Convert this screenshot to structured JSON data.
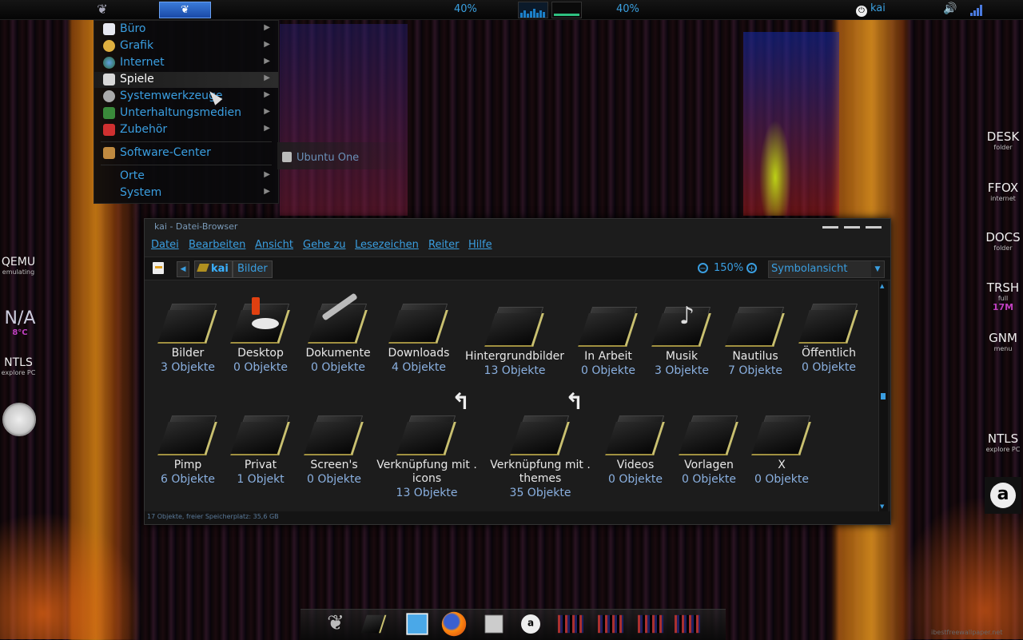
{
  "top_panel": {
    "cpu_left": "40%",
    "cpu_right": "40%",
    "user": "kai",
    "colors": {
      "accent": "#3a9ee0",
      "task_button": "#2a62c8"
    }
  },
  "app_menu": {
    "items": [
      {
        "label": "Büro",
        "icon": "office-icon",
        "has_submenu": true
      },
      {
        "label": "Grafik",
        "icon": "graphics-icon",
        "has_submenu": true
      },
      {
        "label": "Internet",
        "icon": "globe-icon",
        "has_submenu": true
      },
      {
        "label": "Spiele",
        "icon": "games-icon",
        "has_submenu": true,
        "active": true
      },
      {
        "label": "Systemwerkzeuge",
        "icon": "gear-icon",
        "has_submenu": true
      },
      {
        "label": "Unterhaltungsmedien",
        "icon": "media-icon",
        "has_submenu": true
      },
      {
        "label": "Zubehör",
        "icon": "accessories-icon",
        "has_submenu": true
      },
      {
        "label": "Software-Center",
        "icon": "software-center-icon",
        "has_submenu": false
      },
      {
        "label": "Orte",
        "icon": "",
        "has_submenu": true
      },
      {
        "label": "System",
        "icon": "",
        "has_submenu": true
      }
    ],
    "submenu_item": "Ubuntu One"
  },
  "file_window": {
    "title": "kai - Datei-Browser",
    "menu": [
      "Datei",
      "Bearbeiten",
      "Ansicht",
      "Gehe zu",
      "Lesezeichen",
      "Reiter",
      "Hilfe"
    ],
    "breadcrumbs": [
      "kai",
      "Bilder"
    ],
    "zoom": "150%",
    "view_mode": "Symbolansicht",
    "items": [
      {
        "name": "Bilder",
        "count": "3 Objekte",
        "emblem": ""
      },
      {
        "name": "Desktop",
        "count": "0 Objekte",
        "emblem": "candle"
      },
      {
        "name": "Dokumente",
        "count": "0 Objekte",
        "emblem": "brush"
      },
      {
        "name": "Downloads",
        "count": "4 Objekte",
        "emblem": ""
      },
      {
        "name": "Hintergrundbilder",
        "count": "13 Objekte",
        "emblem": ""
      },
      {
        "name": "In Arbeit",
        "count": "0 Objekte",
        "emblem": ""
      },
      {
        "name": "Musik",
        "count": "3 Objekte",
        "emblem": "note"
      },
      {
        "name": "Nautilus",
        "count": "7 Objekte",
        "emblem": ""
      },
      {
        "name": "Öffentlich",
        "count": "0 Objekte",
        "emblem": ""
      },
      {
        "name": "Pimp",
        "count": "6 Objekte",
        "emblem": ""
      },
      {
        "name": "Privat",
        "count": "1 Objekt",
        "emblem": ""
      },
      {
        "name": "Screen's",
        "count": "0 Objekte",
        "emblem": ""
      },
      {
        "name": "Verknüpfung mit . icons",
        "count": "13 Objekte",
        "emblem": "link"
      },
      {
        "name": "Verknüpfung mit . themes",
        "count": "35 Objekte",
        "emblem": "link"
      },
      {
        "name": "Videos",
        "count": "0 Objekte",
        "emblem": ""
      },
      {
        "name": "Vorlagen",
        "count": "0 Objekte",
        "emblem": ""
      },
      {
        "name": "X",
        "count": "0 Objekte",
        "emblem": ""
      }
    ],
    "status": "17 Objekte, freier Speicherplatz: 35,6 GB"
  },
  "desktop_left": [
    {
      "title": "QEMU",
      "sub": "emulating"
    },
    {
      "title": "N/A",
      "sub": "8°C"
    },
    {
      "title": "NTLS",
      "sub": "explore PC"
    }
  ],
  "desktop_right": [
    {
      "title": "DESK",
      "sub": "folder"
    },
    {
      "title": "FFOX",
      "sub": "internet"
    },
    {
      "title": "DOCS",
      "sub": "folder"
    },
    {
      "title": "TRSH",
      "sub": "full",
      "extra": "17M"
    },
    {
      "title": "GNM",
      "sub": "menu"
    },
    {
      "title": "NTLS",
      "sub": "explore PC"
    }
  ],
  "watermark": "ibestfreewallpaper.net"
}
